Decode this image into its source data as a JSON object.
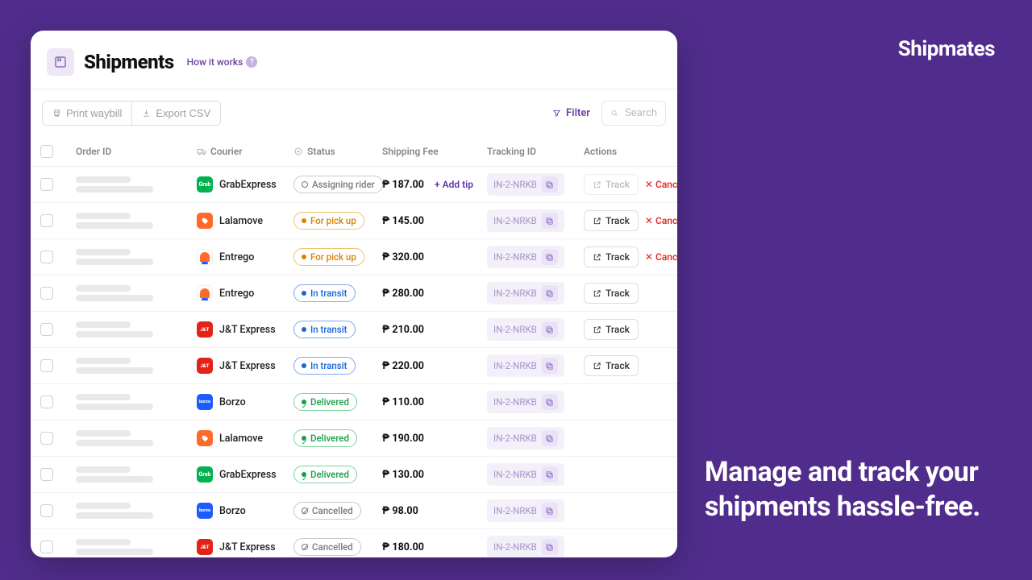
{
  "brand": "Shipmates",
  "tagline": "Manage and track your shipments hassle-free.",
  "header": {
    "title": "Shipments",
    "how_it_works": "How it works"
  },
  "toolbar": {
    "print_waybill": "Print waybill",
    "export_csv": "Export CSV",
    "filter": "Filter",
    "search_placeholder": "Search"
  },
  "columns": {
    "order_id": "Order ID",
    "courier": "Courier",
    "status": "Status",
    "shipping_fee": "Shipping Fee",
    "tracking_id": "Tracking ID",
    "actions": "Actions"
  },
  "couriers": {
    "grab": "GrabExpress",
    "lalamove": "Lalamove",
    "entrego": "Entrego",
    "jnt": "J&T Express",
    "borzo": "Borzo"
  },
  "statuses": {
    "assigning": "Assigning rider",
    "pickup": "For pick up",
    "transit": "In transit",
    "delivered": "Delivered",
    "cancelled": "Cancelled"
  },
  "labels": {
    "add_tip": "+ Add tip",
    "track": "Track",
    "cancel": "Cancel",
    "tracking_sample": "IN-2-NRKB"
  },
  "rows": [
    {
      "courier": "grab",
      "logo": "green",
      "status": "assigning",
      "st_class": "st-gray",
      "fee": "₱ 187.00",
      "addTip": true,
      "track": "disabled",
      "cancel": true
    },
    {
      "courier": "lalamove",
      "logo": "orange",
      "status": "pickup",
      "st_class": "st-amber",
      "fee": "₱ 145.00",
      "addTip": false,
      "track": "enabled",
      "cancel": true
    },
    {
      "courier": "entrego",
      "logo": "ent",
      "status": "pickup",
      "st_class": "st-amber",
      "fee": "₱ 320.00",
      "addTip": false,
      "track": "enabled",
      "cancel": true
    },
    {
      "courier": "entrego",
      "logo": "ent",
      "status": "transit",
      "st_class": "st-blue",
      "fee": "₱ 280.00",
      "addTip": false,
      "track": "enabled",
      "cancel": false
    },
    {
      "courier": "jnt",
      "logo": "red",
      "status": "transit",
      "st_class": "st-blue",
      "fee": "₱ 210.00",
      "addTip": false,
      "track": "enabled",
      "cancel": false
    },
    {
      "courier": "jnt",
      "logo": "red",
      "status": "transit",
      "st_class": "st-blue",
      "fee": "₱ 220.00",
      "addTip": false,
      "track": "enabled",
      "cancel": false
    },
    {
      "courier": "borzo",
      "logo": "blue",
      "status": "delivered",
      "st_class": "st-green",
      "fee": "₱ 110.00",
      "addTip": false,
      "track": "none",
      "cancel": false
    },
    {
      "courier": "lalamove",
      "logo": "orange",
      "status": "delivered",
      "st_class": "st-green",
      "fee": "₱ 190.00",
      "addTip": false,
      "track": "none",
      "cancel": false
    },
    {
      "courier": "grab",
      "logo": "green",
      "status": "delivered",
      "st_class": "st-green",
      "fee": "₱ 130.00",
      "addTip": false,
      "track": "none",
      "cancel": false
    },
    {
      "courier": "borzo",
      "logo": "blue",
      "status": "cancelled",
      "st_class": "st-gray",
      "fee": "₱ 98.00",
      "addTip": false,
      "track": "none",
      "cancel": false
    },
    {
      "courier": "jnt",
      "logo": "red",
      "status": "cancelled",
      "st_class": "st-gray",
      "fee": "₱ 180.00",
      "addTip": false,
      "track": "none",
      "cancel": false
    }
  ]
}
